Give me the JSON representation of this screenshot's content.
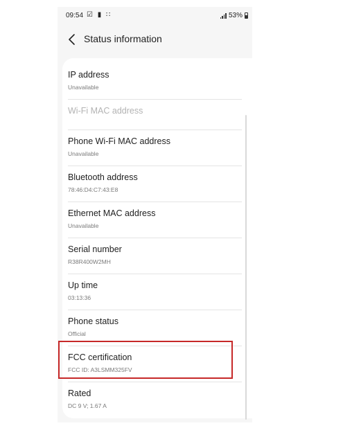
{
  "status_bar": {
    "time": "09:54",
    "left_icons": [
      "notification-icon",
      "lock-icon",
      "apps-icon"
    ],
    "battery": "53%"
  },
  "header": {
    "title": "Status information"
  },
  "items": [
    {
      "label": "IP address",
      "value": "Unavailable",
      "enabled": true
    },
    {
      "label": "Wi-Fi MAC address",
      "value": "",
      "enabled": false
    },
    {
      "label": "Phone Wi-Fi MAC address",
      "value": "Unavailable",
      "enabled": true
    },
    {
      "label": "Bluetooth address",
      "value": "78:46:D4:C7:43:E8",
      "enabled": true
    },
    {
      "label": "Ethernet MAC address",
      "value": "Unavailable",
      "enabled": true
    },
    {
      "label": "Serial number",
      "value": "R38R400W2MH",
      "enabled": true
    },
    {
      "label": "Up time",
      "value": "03:13:36",
      "enabled": true
    },
    {
      "label": "Phone status",
      "value": "Official",
      "enabled": true
    },
    {
      "label": "FCC certification",
      "value": "FCC ID: A3LSMM325FV",
      "enabled": true
    },
    {
      "label": "Rated",
      "value": "DC 9 V; 1.67 A",
      "enabled": true
    }
  ],
  "colors": {
    "highlight": "#c62828",
    "background": "#f6f6f6",
    "card": "#ffffff"
  }
}
